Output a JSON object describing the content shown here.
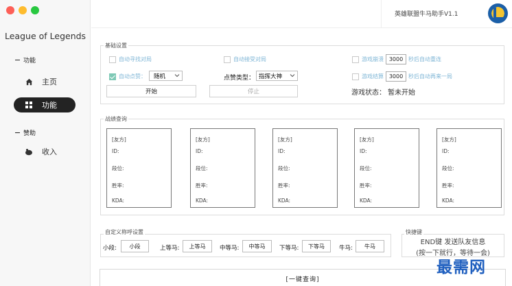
{
  "window": {
    "traffic_colors": [
      "#fd5f57",
      "#febc2e",
      "#28c840"
    ],
    "version": "英雄联盟牛马助手V1.1"
  },
  "sidebar": {
    "app_title": "League of Legends",
    "groups": [
      {
        "label": "功能"
      },
      {
        "label": "赞助"
      }
    ],
    "items": [
      {
        "label": "主页",
        "icon": "home-icon",
        "active": false
      },
      {
        "label": "功能",
        "icon": "grid-icon",
        "active": true
      },
      {
        "label": "收入",
        "icon": "piggy-bank-icon",
        "active": false
      }
    ]
  },
  "basic": {
    "title": "基础设置",
    "auto_find": "自动寻找对局",
    "auto_accept": "自动接受对局",
    "game_crash": "游戏崩溃",
    "crash_ms": "3000",
    "crash_suffix": "秒后自动重连",
    "auto_like": "自动点赞：",
    "like_target": "随机",
    "like_type_label": "点赞类型：",
    "like_type": "指挥大神",
    "game_end": "游戏结算",
    "end_ms": "3000",
    "end_suffix": "秒后自动再来一局",
    "start_button": "开始",
    "stop_button": "停止",
    "status_label": "游戏状态：",
    "status_value": "暂未开始"
  },
  "stats": {
    "title": "战绩查询",
    "cards": [
      {
        "side": "[友方]",
        "id": "ID:",
        "rank": "段位:",
        "winrate": "胜率:",
        "kda": "KDA:"
      },
      {
        "side": "[友方]",
        "id": "ID:",
        "rank": "段位:",
        "winrate": "胜率:",
        "kda": "KDA:"
      },
      {
        "side": "[友方]",
        "id": "ID:",
        "rank": "段位:",
        "winrate": "胜率:",
        "kda": "KDA:"
      },
      {
        "side": "[友方]",
        "id": "ID:",
        "rank": "段位:",
        "winrate": "胜率:",
        "kda": "KDA:"
      },
      {
        "side": "[友方]",
        "id": "ID:",
        "rank": "段位:",
        "winrate": "胜率:",
        "kda": "KDA:"
      }
    ]
  },
  "nicknames": {
    "title": "自定义称呼设置",
    "fields": [
      {
        "label": "小段:",
        "value": "小段"
      },
      {
        "label": "上等马:",
        "value": "上等马"
      },
      {
        "label": "中等马:",
        "value": "中等马"
      },
      {
        "label": "下等马:",
        "value": "下等马"
      },
      {
        "label": "牛马:",
        "value": "牛马"
      }
    ]
  },
  "hotkey": {
    "title": "快捷键",
    "line1": "END键 发送队友信息",
    "line2": "(按一下就行，等待一会)"
  },
  "bottom": {
    "query_button": "[一键查询]"
  },
  "watermark": "最需网"
}
